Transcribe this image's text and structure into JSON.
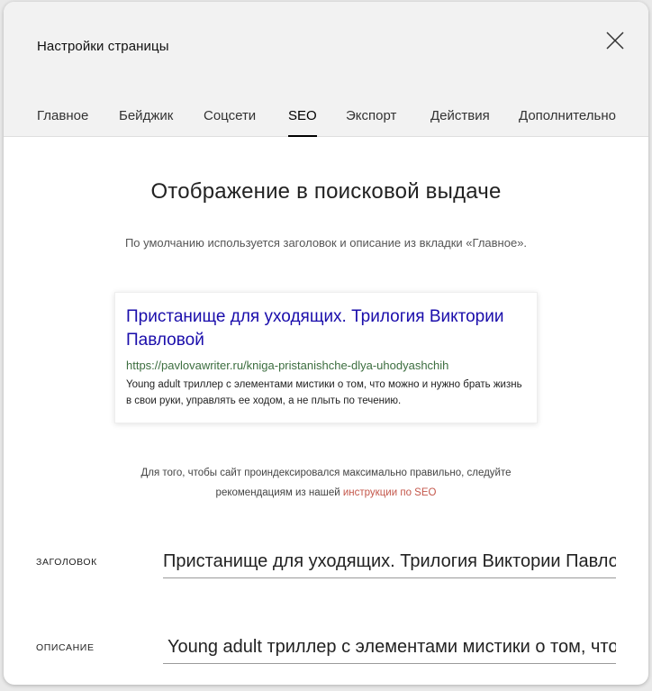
{
  "modal": {
    "title": "Настройки страницы",
    "close_icon": "close-icon"
  },
  "tabs": [
    {
      "label": "Главное",
      "active": false
    },
    {
      "label": "Бейджик",
      "active": false
    },
    {
      "label": "Соцсети",
      "active": false
    },
    {
      "label": "SEO",
      "active": true
    },
    {
      "label": "Экспорт",
      "active": false
    },
    {
      "label": "Действия",
      "active": false
    },
    {
      "label": "Дополнительно",
      "active": false
    }
  ],
  "seo": {
    "section_title": "Отображение в поисковой выдаче",
    "section_desc": "По умолчанию используется заголовок и описание из вкладки «Главное».",
    "preview": {
      "title": "Пристанище для уходящих. Трилогия Виктории Павловой",
      "url": "https://pavlovawriter.ru/kniga-pristanishche-dlya-uhodyashchih",
      "description": "Young adult триллер с элементами мистики о том, что можно и нужно брать жизнь в свои руки, управлять ее ходом, а не плыть по течению."
    },
    "hint_text_1": "Для того, чтобы сайт проиндексировался максимально правильно, следуйте",
    "hint_text_2": "рекомендациям из нашей ",
    "hint_link": "инструкции по SEO",
    "fields": {
      "title_label": "ЗАГОЛОВОК",
      "title_value": "Пристанище для уходящих. Трилогия Виктории Павловой",
      "description_label": "ОПИСАНИЕ",
      "description_value": "Young adult триллер с элементами мистики о том, что можно и нужно брать жизнь в свои руки, управлять ее ходом, а не плыть по течению."
    }
  },
  "colors": {
    "link_title": "#1a0dab",
    "link_url": "#3c6e3f",
    "accent_link": "#c4574b",
    "header_bg": "#f2f2f2"
  }
}
